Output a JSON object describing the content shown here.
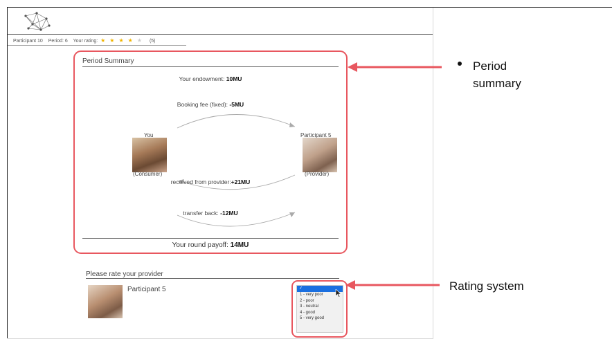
{
  "header": {
    "participant": "Participant 10",
    "period": "Period: 6",
    "rating_label": "Your rating:",
    "stars_filled": 4,
    "stars_total": 5,
    "rating_count": "(5)"
  },
  "summary": {
    "title": "Period Summary",
    "endowment_label": "Your endowment:",
    "endowment_value": "10MU",
    "fee_label": "Booking fee (fixed):",
    "fee_value": "-5MU",
    "you_label": "You",
    "consumer_label": "(Consumer)",
    "partner_label": "Participant 5",
    "provider_label": "(Provider)",
    "received_label": "received from provider:",
    "received_value": "+21MU",
    "transfer_label": "transfer back:",
    "transfer_value": "-12MU",
    "payoff_label": "Your round payoff:",
    "payoff_value": "14MU"
  },
  "rating": {
    "title": "Please rate your provider",
    "provider_name": "Participant 5",
    "selected_mark": "✓",
    "options": [
      "1 - very poor",
      "2 - poor",
      "3 - neutral",
      "4 - good",
      "5 - very good"
    ]
  },
  "annotations": {
    "summary_callout_line1": "Period",
    "summary_callout_line2": "summary",
    "rating_callout": "Rating system",
    "highlight_color": "#e8575f"
  }
}
